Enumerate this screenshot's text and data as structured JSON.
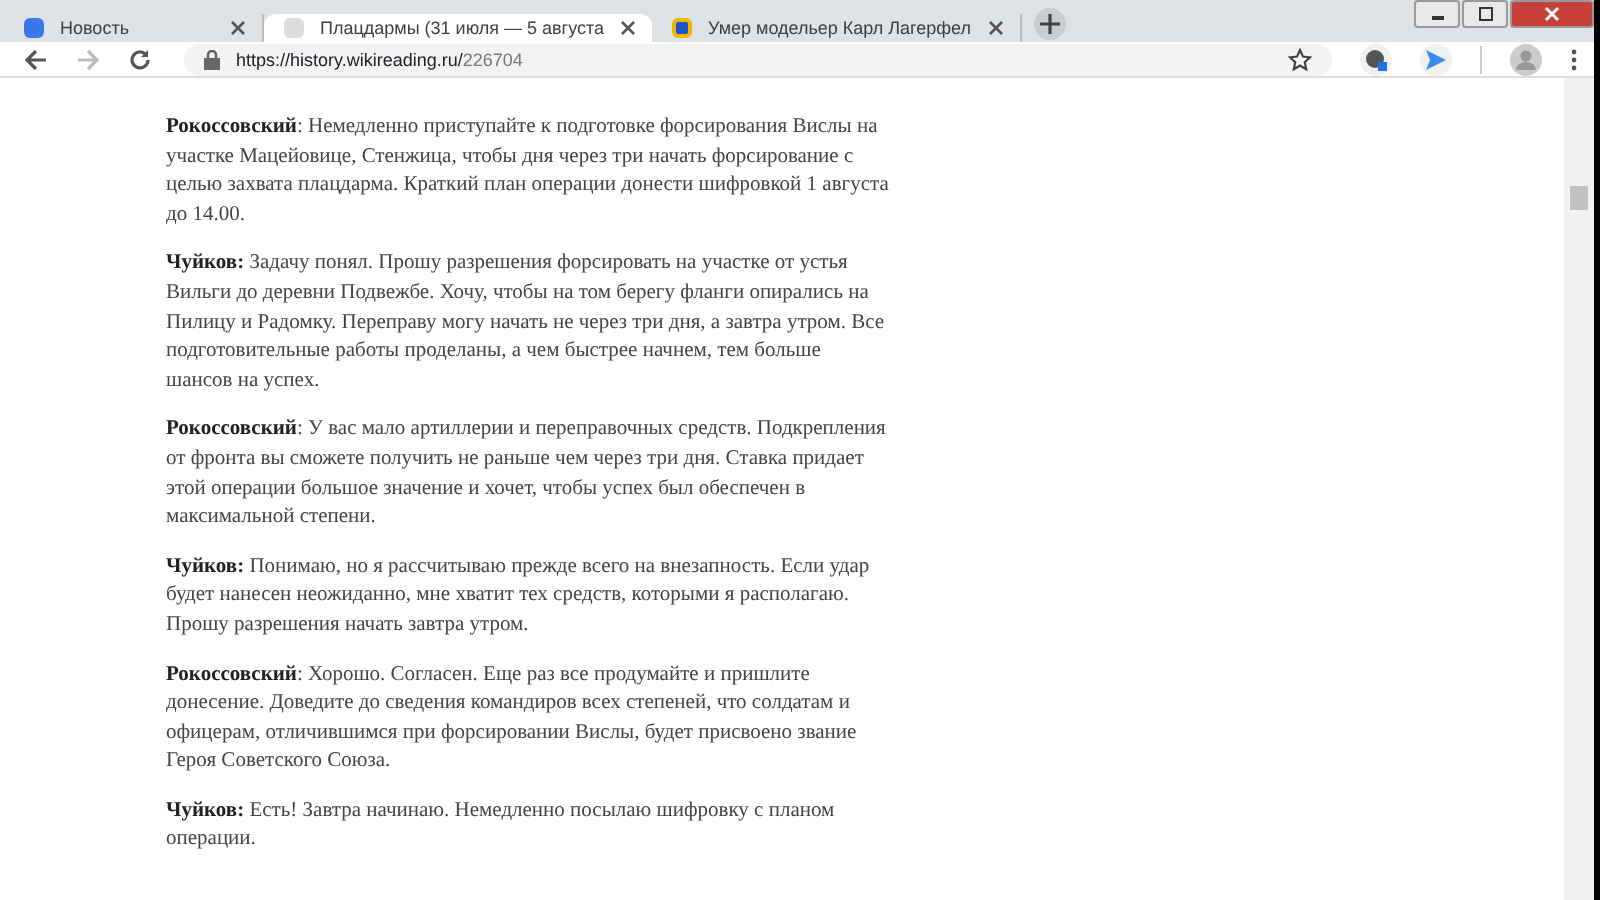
{
  "tabs": [
    {
      "title": "Новость",
      "selected": false
    },
    {
      "title": "Плацдармы (31 июля — 5 августа",
      "selected": true
    },
    {
      "title": "Умер модельер Карл Лагерфел",
      "selected": false
    }
  ],
  "address_bar": {
    "host": "https://history.wikireading.ru/",
    "path": "226704"
  },
  "article": {
    "paragraphs": [
      "**Рокоссовский**: Немедленно приступайте к подготовке форсирования Вислы на участке Мацейовице, Стенжица, чтобы дня через три начать форсирование с целью захвата плацдарма. Краткий план операции донести шифровкой 1 августа до 14.00.",
      "**Чуйков:** Задачу понял. Прошу разрешения форсировать на участке от устья Вильги до деревни Подвежбе. Хочу, чтобы на том берегу фланги опирались на Пилицу и Радомку. Переправу могу начать не через три дня, а завтра утром. Все подготовительные работы проделаны, а чем быстрее начнем, тем больше шансов на успех.",
      "**Рокоссовский**: У вас мало артиллерии и переправочных средств. Подкрепления от фронта вы сможете получить не раньше чем через три дня. Ставка придает этой операции большое значение и хочет, чтобы успех был обеспечен в максимальной степени.",
      "**Чуйков:** Понимаю, но я рассчитываю прежде всего на внезапность. Если удар будет нанесен неожиданно, мне хватит тех средств, которыми я располагаю. Прошу разрешения начать завтра утром.",
      "**Рокоссовский**: Хорошо. Согласен. Еще раз все продумайте и пришлите донесение. Доведите до сведения командиров всех степеней, что солдатам и офицерам, отличившимся при форсировании Вислы, будет присвоено звание Героя Советского Союза.",
      "**Чуйков:** Есть! Завтра начинаю. Немедленно посылаю шифровку с планом операции."
    ]
  }
}
